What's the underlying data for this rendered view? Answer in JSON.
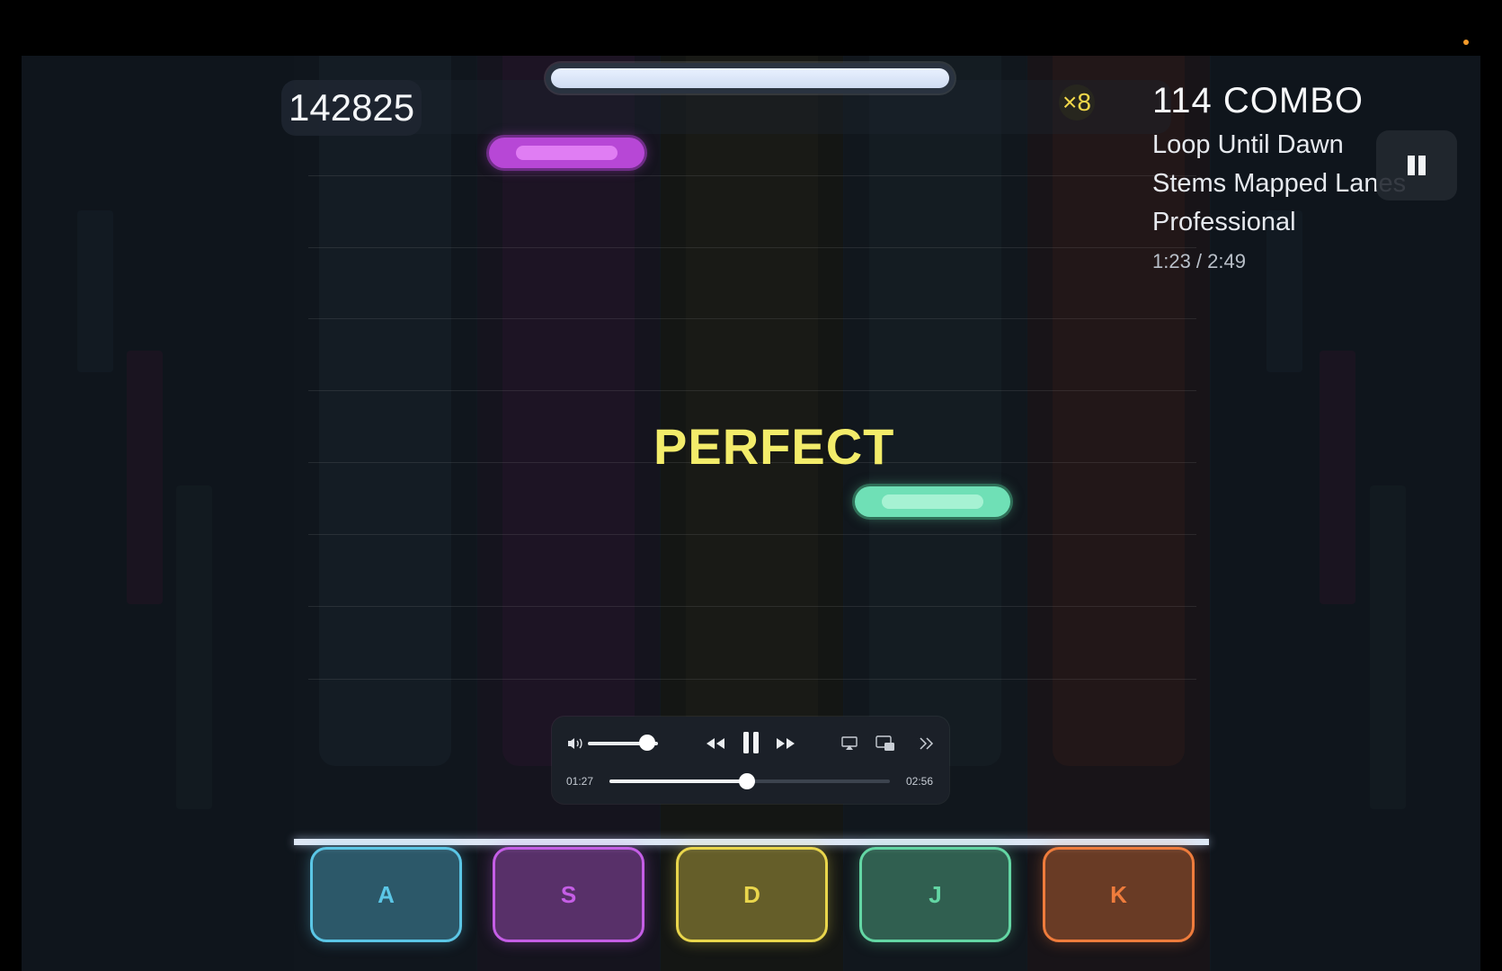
{
  "hud": {
    "score": "142825",
    "multiplier": "×8",
    "combo": "114 COMBO",
    "song_title": "Loop Until Dawn",
    "chart_mode": "Stems Mapped Lanes",
    "difficulty": "Professional",
    "song_time": "1:23 / 2:49",
    "song_progress": 0.49
  },
  "judgement": "PERFECT",
  "lanes": [
    {
      "key": "A",
      "color": "#5bc6e6"
    },
    {
      "key": "S",
      "color": "#c55ee6"
    },
    {
      "key": "D",
      "color": "#e9d64c"
    },
    {
      "key": "J",
      "color": "#63d6a4"
    },
    {
      "key": "K",
      "color": "#ef7c3c"
    }
  ],
  "media_player": {
    "current_time": "01:27",
    "total_time": "02:56",
    "seek_progress": 0.49,
    "volume_level": 0.85,
    "icons": [
      "volume-icon",
      "rewind-icon",
      "pause-icon",
      "fast-forward-icon",
      "airplay-icon",
      "picture-in-picture-icon",
      "more-icon"
    ]
  }
}
